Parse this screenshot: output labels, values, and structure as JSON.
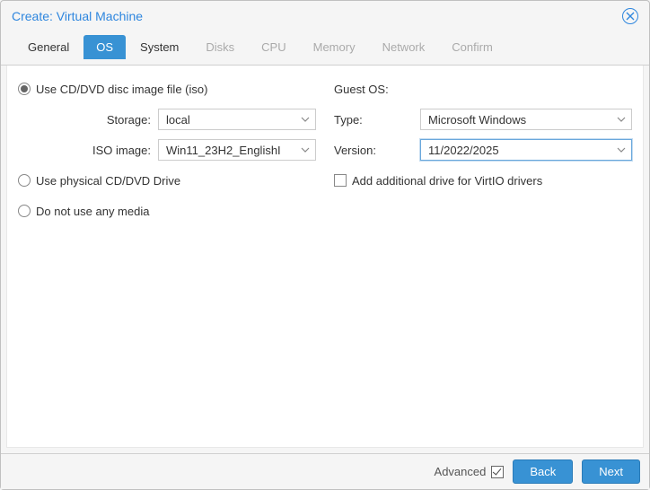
{
  "title": "Create: Virtual Machine",
  "tabs": [
    {
      "label": "General",
      "state": "enabled"
    },
    {
      "label": "OS",
      "state": "active"
    },
    {
      "label": "System",
      "state": "enabled"
    },
    {
      "label": "Disks",
      "state": "disabled"
    },
    {
      "label": "CPU",
      "state": "disabled"
    },
    {
      "label": "Memory",
      "state": "disabled"
    },
    {
      "label": "Network",
      "state": "disabled"
    },
    {
      "label": "Confirm",
      "state": "disabled"
    }
  ],
  "left": {
    "radio_iso": "Use CD/DVD disc image file (iso)",
    "storage_label": "Storage:",
    "storage_value": "local",
    "iso_label": "ISO image:",
    "iso_value": "Win11_23H2_EnglishI",
    "radio_physical": "Use physical CD/DVD Drive",
    "radio_none": "Do not use any media",
    "media_selection": "iso"
  },
  "right": {
    "guest_os_label": "Guest OS:",
    "type_label": "Type:",
    "type_value": "Microsoft Windows",
    "version_label": "Version:",
    "version_value": "11/2022/2025",
    "virtio_label": "Add additional drive for VirtIO drivers",
    "virtio_checked": false
  },
  "footer": {
    "advanced_label": "Advanced",
    "advanced_checked": true,
    "back_label": "Back",
    "next_label": "Next"
  }
}
